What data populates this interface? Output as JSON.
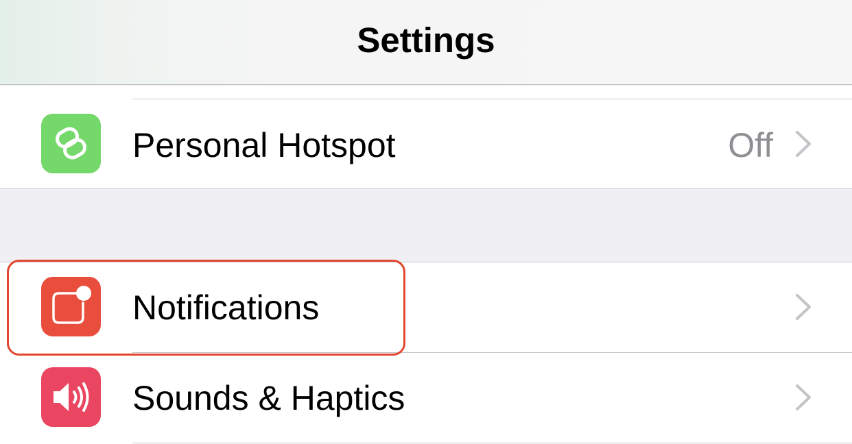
{
  "nav": {
    "title": "Settings"
  },
  "rows": [
    {
      "label": "Personal Hotspot",
      "value": "Off",
      "icon": "personal-hotspot-icon",
      "icon_color": "#75d86a"
    },
    {
      "label": "Notifications",
      "value": "",
      "icon": "notifications-icon",
      "icon_color": "#e94e3d"
    },
    {
      "label": "Sounds & Haptics",
      "value": "",
      "icon": "sounds-icon",
      "icon_color": "#ea4561"
    }
  ],
  "highlight": {
    "target": "Notifications",
    "color": "#e2462e"
  }
}
